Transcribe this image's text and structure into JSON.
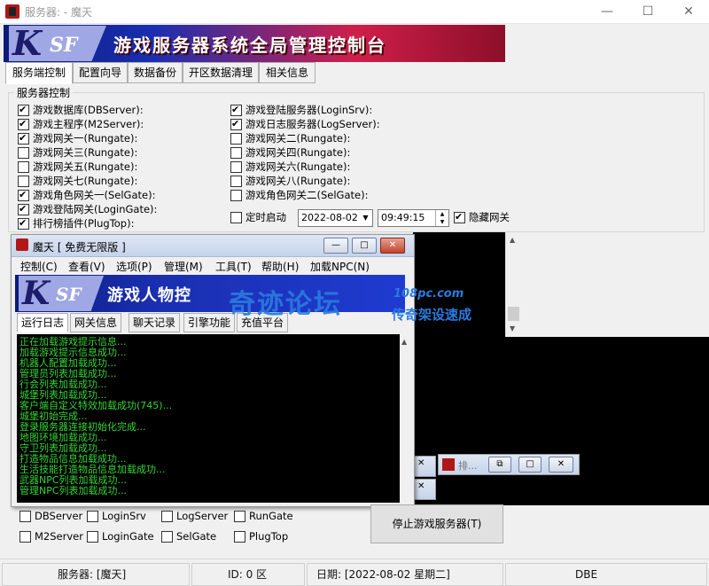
{
  "window": {
    "title": "服务器: - 魔天",
    "minimize": "—",
    "maximize": "☐",
    "close": "✕"
  },
  "banner": {
    "logo_k": "K",
    "logo_sf": "SF",
    "text": "游戏服务器系统全局管理控制台"
  },
  "tabs": [
    "服务端控制",
    "配置向导",
    "数据备份",
    "开区数据清理",
    "相关信息"
  ],
  "server_control": {
    "label": "服务器控制",
    "left": [
      {
        "label": "游戏数据库(DBServer):",
        "checked": true
      },
      {
        "label": "游戏主程序(M2Server):",
        "checked": true
      },
      {
        "label": "游戏网关一(Rungate):",
        "checked": true
      },
      {
        "label": "游戏网关三(Rungate):",
        "checked": false
      },
      {
        "label": "游戏网关五(Rungate):",
        "checked": false
      },
      {
        "label": "游戏网关七(Rungate):",
        "checked": false
      },
      {
        "label": "游戏角色网关一(SelGate):",
        "checked": true
      },
      {
        "label": "游戏登陆网关(LoginGate):",
        "checked": true
      },
      {
        "label": "排行榜插件(PlugTop):",
        "checked": true
      }
    ],
    "right": [
      {
        "label": "游戏登陆服务器(LoginSrv):",
        "checked": true
      },
      {
        "label": "游戏日志服务器(LogServer):",
        "checked": true
      },
      {
        "label": "游戏网关二(Rungate):",
        "checked": false
      },
      {
        "label": "游戏网关四(Rungate):",
        "checked": false
      },
      {
        "label": "游戏网关六(Rungate):",
        "checked": false
      },
      {
        "label": "游戏网关八(Rungate):",
        "checked": false
      },
      {
        "label": "游戏角色网关二(SelGate):",
        "checked": false
      }
    ],
    "timed_start": {
      "label": "定时启动",
      "checked": false
    },
    "date": "2022-08-02",
    "time": "09:49:15",
    "hide_gate": {
      "label": "隐藏网关",
      "checked": true
    }
  },
  "inner_window": {
    "title": "魔天 [ 免费无限版 ]",
    "menu": [
      "控制(C)",
      "查看(V)",
      "选项(P)",
      "管理(M)",
      "工具(T)",
      "帮助(H)",
      "加载NPC(N)"
    ],
    "banner_text": "游戏人物控",
    "tabs": [
      "运行日志",
      "网关信息",
      "聊天记录",
      "引擎功能",
      "充值平台"
    ],
    "log": [
      "正在加载游戏提示信息...",
      "加载游戏提示信息成功...",
      "机器人配置加载成功...",
      "管理员列表加载成功...",
      "行会列表加载成功...",
      "城堡列表加载成功...",
      "客户端自定义特效加载成功(745)...",
      "城堡初始完成...",
      "登录服务器连接初始化完成...",
      "地图环境加载成功...",
      "守卫列表加载成功...",
      "打造物品信息加载成功...",
      "生活技能打造物品信息加载成功...",
      "武器NPC列表加载成功...",
      "管理NPC列表加载成功..."
    ]
  },
  "watermark": {
    "main": "奇迹论坛",
    "site": "108pc.com",
    "slogan": "传奇架设速成"
  },
  "mini_window": {
    "title": "排..."
  },
  "bottom_checks": [
    {
      "label": "DBServer",
      "checked": false
    },
    {
      "label": "LoginSrv",
      "checked": false
    },
    {
      "label": "LogServer",
      "checked": false
    },
    {
      "label": "RunGate",
      "checked": false
    },
    {
      "label": "M2Server",
      "checked": false
    },
    {
      "label": "LoginGate",
      "checked": false
    },
    {
      "label": "SelGate",
      "checked": false
    },
    {
      "label": "PlugTop",
      "checked": false
    }
  ],
  "stop_button": "停止游戏服务器(T)",
  "status": {
    "server": "服务器:  [魔天]",
    "id": "ID: 0 区",
    "date": "日期:  [2022-08-02 星期二]",
    "code": "DBE"
  }
}
